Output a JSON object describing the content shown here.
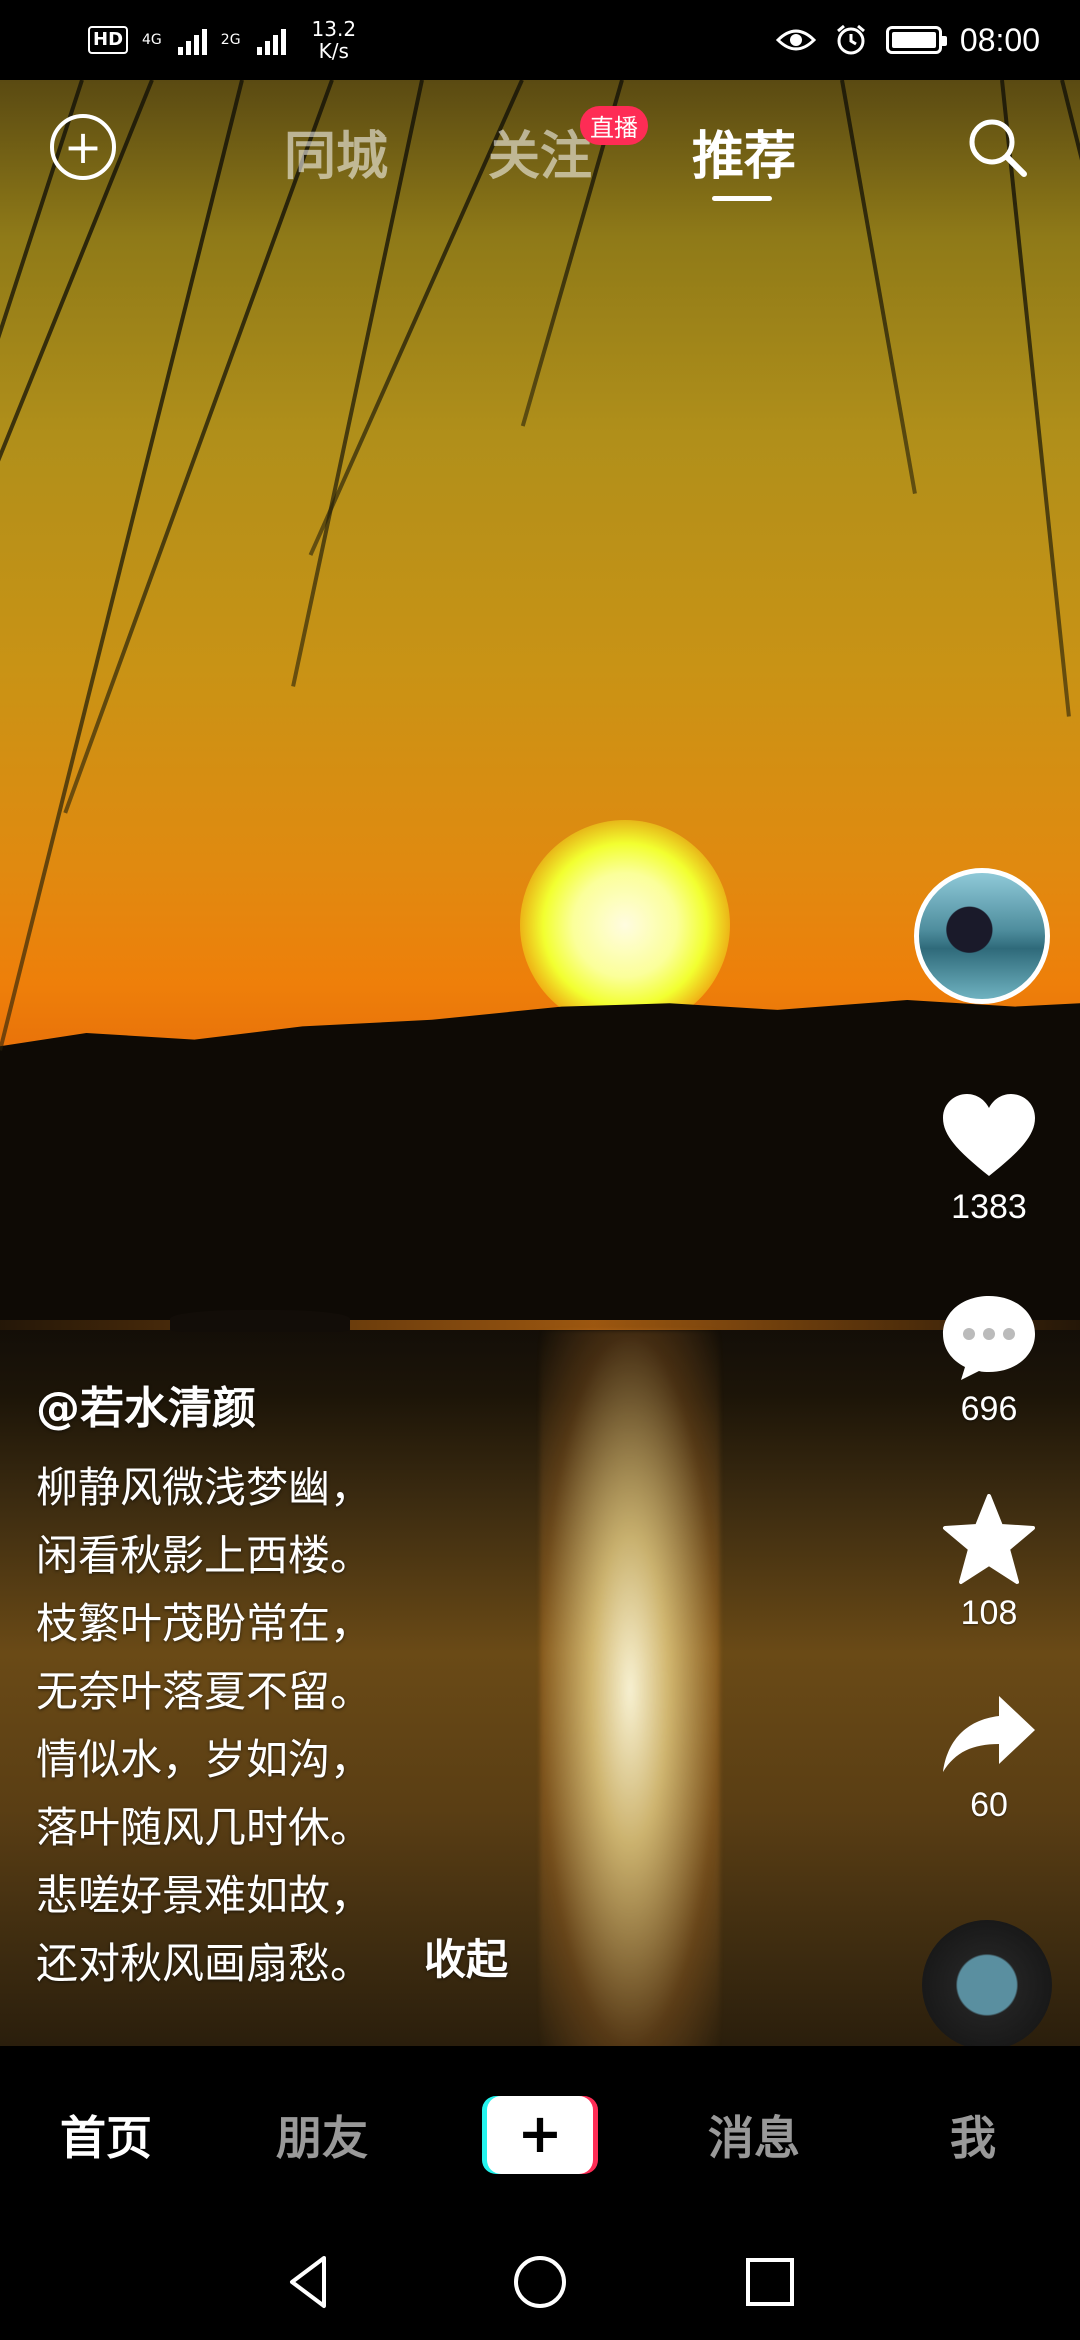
{
  "status_bar": {
    "hd": "HD",
    "sim1_tag": "4G",
    "sim2_tag": "2G",
    "speed_value": "13.2",
    "speed_unit": "K/s",
    "time": "08:00"
  },
  "top_nav": {
    "tabs": [
      {
        "label": "同城"
      },
      {
        "label": "关注",
        "badge": "直播"
      },
      {
        "label": "推荐",
        "active": true
      }
    ]
  },
  "rail": {
    "likes": "1383",
    "comments": "696",
    "favorites": "108",
    "shares": "60"
  },
  "caption": {
    "author": "@若水清颜",
    "lines": [
      "柳静风微浅梦幽，",
      "闲看秋影上西楼。",
      "枝繁叶茂盼常在，",
      "无奈叶落夏不留。",
      "情似水，岁如沟，",
      "落叶随风几时休。",
      "悲嗟好景难如故，",
      "还对秋风画扇愁。"
    ],
    "collapse": "收起"
  },
  "bottom_nav": {
    "items": [
      {
        "label": "首页",
        "active": true
      },
      {
        "label": "朋友"
      },
      {
        "label": "消息"
      },
      {
        "label": "我"
      }
    ],
    "create_symbol": "+"
  },
  "icons": {
    "add": "plus-circle-icon",
    "search": "search-icon",
    "like": "heart-icon",
    "comment": "comment-bubble-icon",
    "favorite": "star-icon",
    "share": "share-arrow-icon",
    "back": "back-triangle-icon",
    "home": "home-circle-icon",
    "recents": "recents-square-icon"
  },
  "colors": {
    "accent": "#fe2c55",
    "accent_cyan": "#25f4ee"
  }
}
